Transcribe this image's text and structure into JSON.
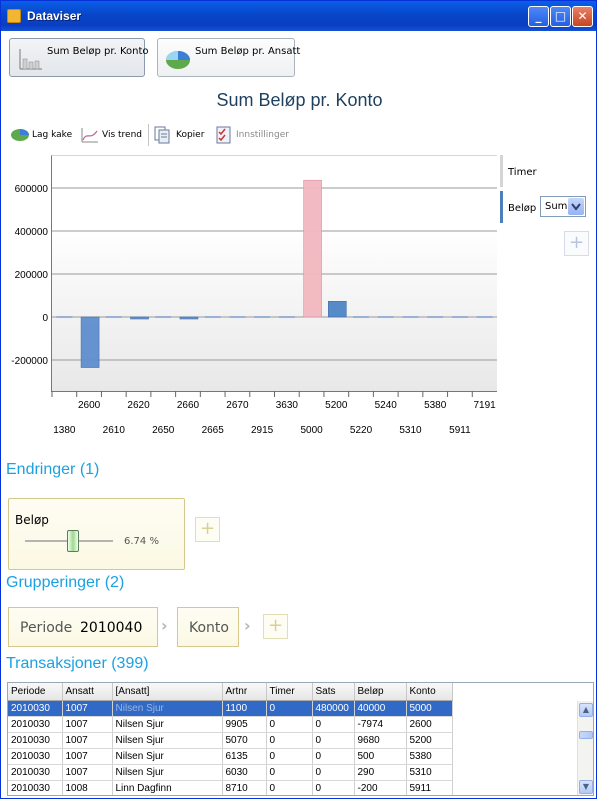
{
  "window": {
    "title": "Dataviser",
    "min": "_",
    "max": "□",
    "close": "✕"
  },
  "view_buttons": [
    {
      "label": "Sum Beløp pr. Konto",
      "icon": "bar-chart-icon",
      "selected": true
    },
    {
      "label": "Sum Beløp pr. Ansatt",
      "icon": "pie-chart-icon",
      "selected": false
    }
  ],
  "chart_title": "Sum Beløp pr. Konto",
  "toolbar": {
    "pie": "Lag kake",
    "trend": "Vis trend",
    "copy": "Kopier",
    "settings": "Innstillinger"
  },
  "legend": {
    "timer": "Timer",
    "belop": "Beløp",
    "aggregate": "Sum",
    "add": "+"
  },
  "chart_data": {
    "type": "bar",
    "categories": [
      "1380",
      "2600",
      "2610",
      "2620",
      "2650",
      "2660",
      "2665",
      "2670",
      "2915",
      "3630",
      "5000",
      "5200",
      "5220",
      "5240",
      "5310",
      "5380",
      "5911",
      "7191"
    ],
    "series": [
      {
        "name": "Beløp",
        "values": [
          0,
          -235000,
          0,
          -5000,
          0,
          -7974,
          0,
          0,
          0,
          0,
          636000,
          73000,
          0,
          0,
          0,
          0,
          0,
          0
        ]
      },
      {
        "name": "Timer",
        "values": [
          0,
          0,
          0,
          0,
          0,
          0,
          0,
          0,
          0,
          0,
          0,
          0,
          0,
          0,
          0,
          0,
          0,
          0
        ]
      }
    ],
    "yticks": [
      600000,
      400000,
      200000,
      0,
      -200000
    ],
    "ylim": [
      -340000,
      750000
    ],
    "xlabels_top": [
      "2600",
      "2620",
      "2660",
      "2670",
      "3630",
      "5200",
      "5240",
      "5380",
      "7191"
    ],
    "xlabels_bottom": [
      "1380",
      "2610",
      "2650",
      "2665",
      "2915",
      "5000",
      "5220",
      "5310",
      "5911"
    ],
    "colors": {
      "negative": "#5f8fcf",
      "highlight": "#f2b8c0",
      "positive": "#4f86c6"
    }
  },
  "sections": {
    "changes": "Endringer (1)",
    "groupings": "Grupperinger (2)",
    "transactions": "Transaksjoner (399)"
  },
  "filter": {
    "name": "Beløp",
    "value": "6.74 %",
    "level": 0.48
  },
  "groupings": {
    "periode_key": "Periode",
    "periode_value": "2010040",
    "konto": "Konto",
    "add": "+"
  },
  "table": {
    "columns": [
      "Periode",
      "Ansatt",
      "[Ansatt]",
      "Artnr",
      "Timer",
      "Sats",
      "Beløp",
      "Konto"
    ],
    "rows": [
      [
        "2010030",
        "1007",
        "Nilsen Sjur",
        "1100",
        "0",
        "480000",
        "40000",
        "5000"
      ],
      [
        "2010030",
        "1007",
        "Nilsen Sjur",
        "9905",
        "0",
        "0",
        "-7974",
        "2600"
      ],
      [
        "2010030",
        "1007",
        "Nilsen Sjur",
        "5070",
        "0",
        "0",
        "9680",
        "5200"
      ],
      [
        "2010030",
        "1007",
        "Nilsen Sjur",
        "6135",
        "0",
        "0",
        "500",
        "5380"
      ],
      [
        "2010030",
        "1007",
        "Nilsen Sjur",
        "6030",
        "0",
        "0",
        "290",
        "5310"
      ],
      [
        "2010030",
        "1008",
        "Linn Dagfinn",
        "8710",
        "0",
        "0",
        "-200",
        "5911"
      ]
    ]
  }
}
